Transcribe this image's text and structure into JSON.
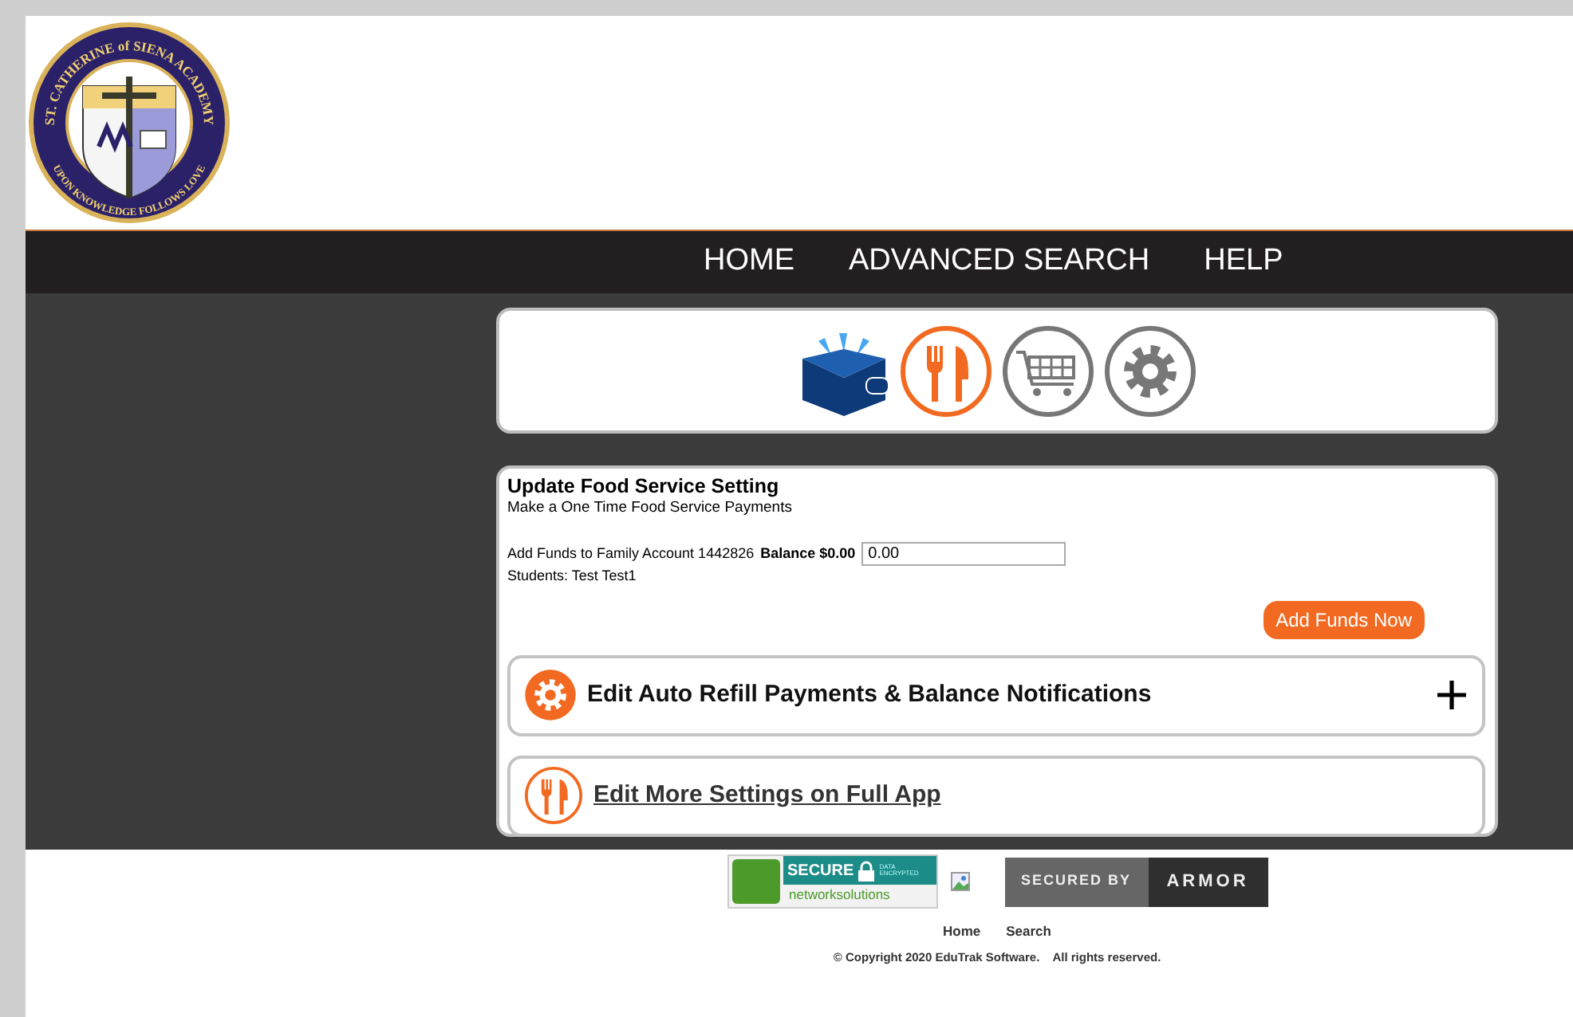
{
  "logo": {
    "top_text": "ST. CATHERINE of SIENA ACADEMY",
    "bottom_text": "UPON KNOWLEDGE FOLLOWS LOVE"
  },
  "nav": [
    {
      "label": "HOME"
    },
    {
      "label": "ADVANCED SEARCH"
    },
    {
      "label": "HELP"
    }
  ],
  "app_icons": [
    {
      "kind": "wallet",
      "selected": false
    },
    {
      "kind": "food",
      "selected": true
    },
    {
      "kind": "cart",
      "selected": false
    },
    {
      "kind": "settings",
      "selected": false
    }
  ],
  "form": {
    "title": "Update Food Service Setting",
    "subtitle": "Make a One Time Food Service Payments",
    "account_label": "Add Funds to Family Account 1442826",
    "balance": "Balance $0.00",
    "amount": "0.00",
    "students": "Students: Test Test1",
    "button": "Add Funds Now"
  },
  "panels": [
    {
      "kind": "expandable",
      "label": "Edit Auto Refill Payments & Balance Notifications",
      "expanded": false
    },
    {
      "kind": "link",
      "label": "Edit More Settings on Full App"
    }
  ],
  "footer": {
    "badges": [
      {
        "kind": "network",
        "text": "SECURE",
        "small": "DATA ENCRYPTED",
        "brand": "networksolutions"
      },
      {
        "kind": "broken"
      },
      {
        "kind": "armor",
        "text": "SECURED BY",
        "brand": "ARMOR"
      }
    ],
    "links": [
      "Home",
      "Search"
    ],
    "copyright": "© Copyright 2020 EduTrak Software.    All rights reserved."
  }
}
